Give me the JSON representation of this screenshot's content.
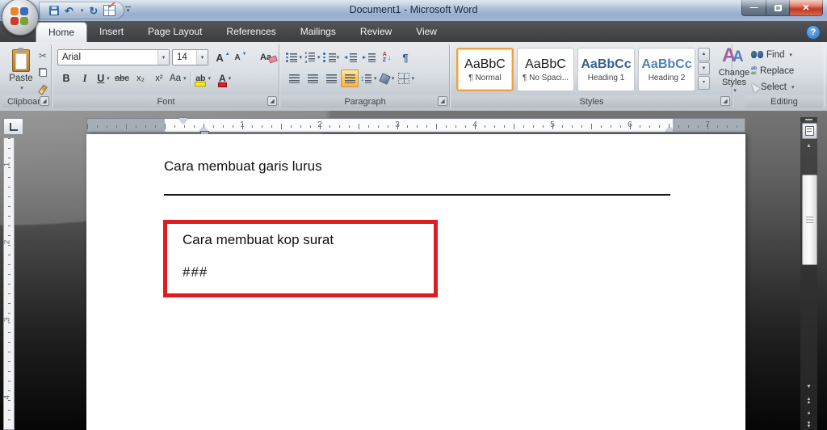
{
  "window": {
    "title": "Document1 - Microsoft Word"
  },
  "titlebar": {
    "minimize": "—",
    "close": "✕"
  },
  "glyphs": {
    "dropdown": "▾",
    "up": "▲",
    "down": "▼",
    "down_arrow": "↓",
    "updown": "↕",
    "left_tri": "◄",
    "right_tri": "►",
    "launcher": "◢"
  },
  "icons": {
    "office-logo": "css-four-squares",
    "save": "css-floppy",
    "undo": "↶",
    "redo": "↻",
    "draw-table": "css-table-pencil",
    "qat-more": "▾",
    "minimize": "—",
    "restore": "css-two-squares",
    "close": "✕",
    "help": "?",
    "paste-clipboard": "css-clipboard",
    "cut": "✂",
    "copy": "css-pages",
    "format-painter": "css-brush",
    "bullets": "css-dot-list",
    "numbering": "css-num-list",
    "multilevel-list": "css-multilevel",
    "sort": "AZ↓",
    "pilcrow": "¶",
    "align": "css-lines",
    "line-spacing": "↕",
    "shading": "css-bucket",
    "borders": "css-grid",
    "find": "css-binoculars",
    "replace": "ab-ac",
    "select": "css-cursor",
    "scroll-up": "▲",
    "scroll-down": "▼",
    "prev-page": "▲▲",
    "browse-object": "●",
    "next-page": "▼▼",
    "view-ruler": "css-ruler",
    "tab-stop": "css-L"
  },
  "qat": {
    "undo": "↶",
    "redo": "↻"
  },
  "help_glyph": "?",
  "tabs": [
    {
      "label": "Home",
      "active": true
    },
    {
      "label": "Insert"
    },
    {
      "label": "Page Layout"
    },
    {
      "label": "References"
    },
    {
      "label": "Mailings"
    },
    {
      "label": "Review"
    },
    {
      "label": "View"
    }
  ],
  "ribbon": {
    "clipboard": {
      "label": "Clipboard",
      "paste": "Paste",
      "cut": "✂"
    },
    "font": {
      "label": "Font",
      "name": "Arial",
      "size": "14",
      "bold": "B",
      "italic": "I",
      "underline": "U",
      "strike": "abc",
      "subscript": "x₂",
      "superscript": "x²",
      "change_case": "Aa",
      "clear_format": "Aa",
      "highlight": "ab",
      "font_color": "A",
      "grow": "A",
      "shrink": "A"
    },
    "paragraph": {
      "label": "Paragraph",
      "sort_a": "A",
      "sort_z": "Z",
      "pilcrow": "¶"
    },
    "styles": {
      "label": "Styles",
      "change_styles": "Change Styles",
      "items": [
        {
          "preview": "AaBbC",
          "name": "¶ Normal",
          "selected": true
        },
        {
          "preview": "AaBbC",
          "name": "¶ No Spaci..."
        },
        {
          "preview": "AaBbCc",
          "name": "Heading 1"
        },
        {
          "preview": "AaBbCc",
          "name": "Heading 2"
        }
      ]
    },
    "editing": {
      "label": "Editing",
      "find": "Find",
      "replace": "Replace",
      "select": "Select",
      "replace_top": "ab",
      "replace_bottom": "ac"
    }
  },
  "ruler": {
    "h_numbers": [
      "1",
      "2",
      "3",
      "4",
      "5",
      "6",
      "7"
    ],
    "v_numbers": [
      "1",
      "2",
      "3",
      "4"
    ]
  },
  "document": {
    "heading": "Cara membuat garis lurus",
    "box_title": "Cara membuat kop surat",
    "box_marks": "###"
  },
  "colors": {
    "annotation_red": "#e11b22",
    "heading1_blue": "#365f91",
    "heading2_blue": "#4f81bd",
    "active_button_orange": "#f9b64d",
    "close_button_red": "#c23a22"
  }
}
